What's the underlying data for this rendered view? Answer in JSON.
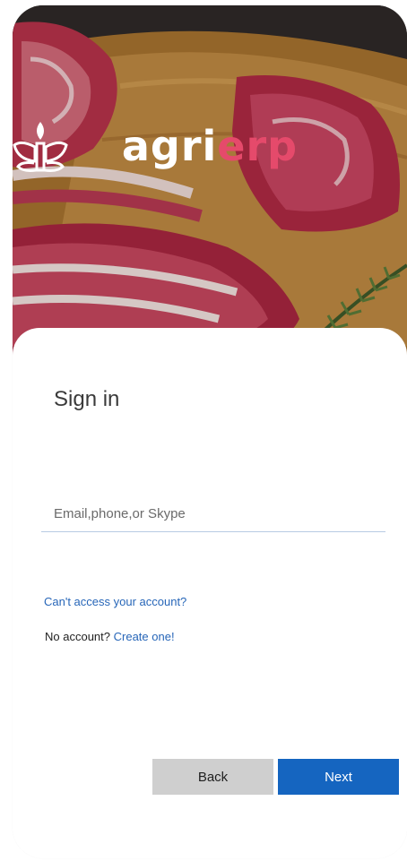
{
  "brand": {
    "logo_icon": "leaf-sprout-icon",
    "wordmark_part1": "agri",
    "wordmark_part2": "erp",
    "accent_color": "#e54a6b"
  },
  "signin": {
    "title": "Sign in",
    "email_placeholder": "Email,phone,or Skype",
    "email_value": "",
    "cant_access_link": "Can't access your account?",
    "no_account_text": "No account?",
    "create_link": "Create one!"
  },
  "buttons": {
    "back_label": "Back",
    "next_label": "Next",
    "primary_color": "#1565c0"
  }
}
